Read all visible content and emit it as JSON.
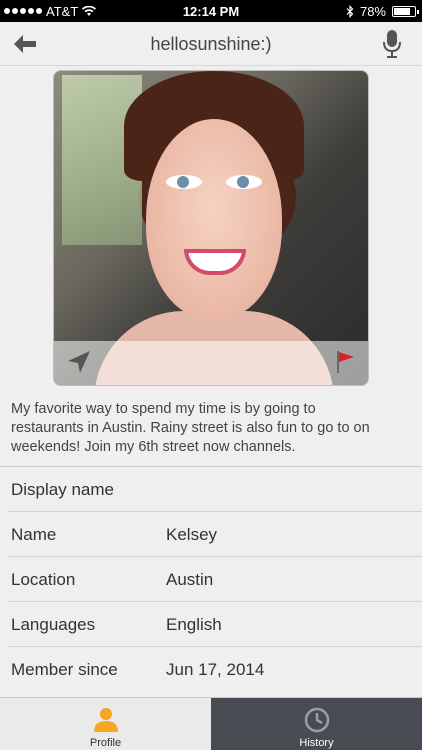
{
  "status_bar": {
    "carrier": "AT&T",
    "time": "12:14 PM",
    "battery": "78%",
    "battery_level": 0.78
  },
  "nav": {
    "title": "hellosunshine:)",
    "back_icon": "back-arrow-icon",
    "mic_icon": "microphone-icon"
  },
  "photo": {
    "locate_icon": "location-arrow-icon",
    "flag_icon": "report-flag-icon"
  },
  "bio": "My favorite way to spend my time is by going to restaurants in Austin. Rainy street is also fun to go to on weekends! Join my 6th street now channels.",
  "details": {
    "display_name_label": "Display name",
    "rows": [
      {
        "label": "Name",
        "value": "Kelsey"
      },
      {
        "label": "Location",
        "value": "Austin"
      },
      {
        "label": "Languages",
        "value": "English"
      },
      {
        "label": "Member since",
        "value": "Jun 17, 2014"
      }
    ]
  },
  "tabs": [
    {
      "label": "Profile",
      "icon": "person-icon",
      "active": true
    },
    {
      "label": "History",
      "icon": "history-clock-icon",
      "active": false
    }
  ],
  "colors": {
    "accent": "#f5a623",
    "tab_dark": "#484c52",
    "flag": "#e02020"
  }
}
